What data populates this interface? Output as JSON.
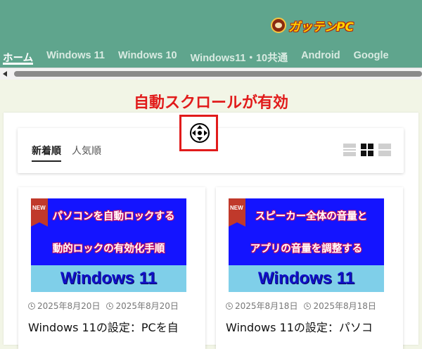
{
  "header": {
    "site_name": "ガッテンPC",
    "logo_icon": "logo-face-icon",
    "colors": {
      "background": "#5fa58d",
      "logo_text": "#ffd400",
      "nav_active": "#ffffff"
    }
  },
  "nav": {
    "items": [
      {
        "label": "ホーム",
        "active": true
      },
      {
        "label": "Windows 11",
        "active": false
      },
      {
        "label": "Windows 10",
        "active": false
      },
      {
        "label": "Windows11・10共通",
        "active": false
      },
      {
        "label": "Android",
        "active": false
      },
      {
        "label": "Google",
        "active": false
      }
    ]
  },
  "annotation": {
    "label": "自動スクロールが有効",
    "icon": "autoscroll-icon",
    "color": "#e11b1b"
  },
  "sort": {
    "tabs": [
      {
        "label": "新着順",
        "active": true
      },
      {
        "label": "人気順",
        "active": false
      }
    ],
    "view_options": [
      "list-view-icon",
      "grid-view-icon",
      "wide-view-icon"
    ],
    "selected_view": "grid-view-icon"
  },
  "articles": [
    {
      "badge": "NEW",
      "thumb_line1": "パソコンを自動ロックする",
      "thumb_line2": "動的ロックの有効化手順",
      "thumb_os": "Windows 11",
      "published": "2025年8月20日",
      "updated": "2025年8月20日",
      "title": "Windows 11の設定：PCを自"
    },
    {
      "badge": "NEW",
      "thumb_line1": "スピーカー全体の音量と",
      "thumb_line2": "アプリの音量を調整する",
      "thumb_os": "Windows 11",
      "published": "2025年8月18日",
      "updated": "2025年8月18日",
      "title": "Windows 11の設定：パソコ"
    }
  ]
}
